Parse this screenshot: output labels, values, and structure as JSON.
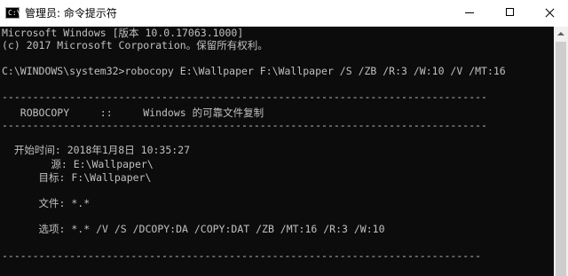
{
  "window": {
    "title": "管理员: 命令提示符",
    "icon_text": "C:\\"
  },
  "console": {
    "header1": "Microsoft Windows [版本 10.0.17063.1000]",
    "header2": "(c) 2017 Microsoft Corporation。保留所有权利。",
    "prompt": "C:\\WINDOWS\\system32>robocopy E:\\Wallpaper F:\\Wallpaper /S /ZB /R:3 /W:10 /V /MT:16",
    "separator": "-------------------------------------------------------------------------------",
    "banner": "   ROBOCOPY     ::     Windows 的可靠文件复制",
    "start_time": "  开始时间: 2018年1月8日 10:35:27",
    "source": "        源: E:\\Wallpaper\\",
    "target": "      目标: F:\\Wallpaper\\",
    "files": "      文件: *.*",
    "options": "      选项: *.* /V /S /DCOPY:DA /COPY:DAT /ZB /MT:16 /R:3 /W:10",
    "short_separator": "------------------------------------------------------------------------------"
  }
}
